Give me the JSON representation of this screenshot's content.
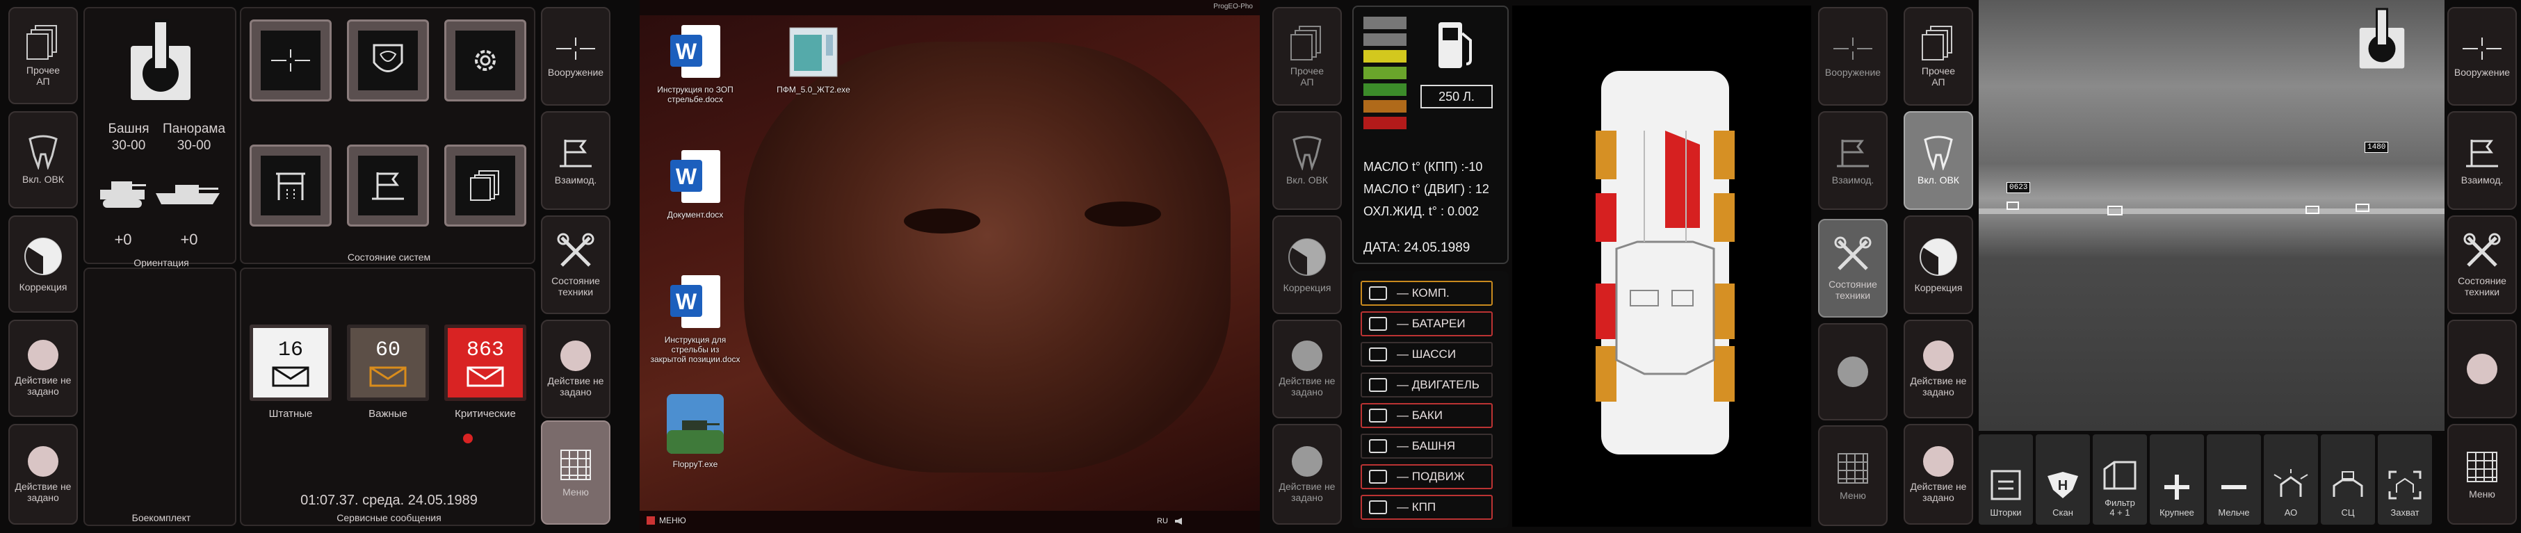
{
  "left_sidebar": {
    "items": [
      {
        "label": "Прочее\nАП",
        "icon": "documents-icon"
      },
      {
        "label": "Вкл. ОВК",
        "icon": "tooth-icon"
      },
      {
        "label": "Коррекция",
        "icon": "correction-icon"
      },
      {
        "label": "Действие не\nзадано",
        "icon": "dot-icon"
      },
      {
        "label": "Действие не\nзадано",
        "icon": "dot-icon"
      }
    ]
  },
  "orientation": {
    "tower_label": "Башня\n30-00",
    "panorama_label": "Панорама\n30-00",
    "tank_value": "+0",
    "boat_value": "+0",
    "title": "Ориентация"
  },
  "systems": {
    "title": "Состояние систем"
  },
  "ammo": {
    "title": "Боекомплект"
  },
  "service": {
    "title": "Сервисные сообщения",
    "datetime": "01:07.37. среда. 24.05.1989",
    "messages": [
      {
        "count": "16",
        "label": "Штатные",
        "color": "#f2f2f2"
      },
      {
        "count": "60",
        "label": "Важные",
        "color": "#5c4f47"
      },
      {
        "count": "863",
        "label": "Критические",
        "color": "#d92323"
      }
    ]
  },
  "right_col1": {
    "items": [
      {
        "label": "Вооружение"
      },
      {
        "label": "Взаимод."
      },
      {
        "label": "Состояние\nтехники"
      },
      {
        "label": "Действие не\nзадано"
      },
      {
        "label": "Меню"
      }
    ]
  },
  "desktop": {
    "topbar_text": "ProgEO-Pho",
    "icons": [
      {
        "label": "Инструкция по ЗОП\nстрельбе.docx"
      },
      {
        "label": "ПФМ_5.0_ЖТ2.exe"
      },
      {
        "label": "Документ.docx"
      },
      {
        "label": "Инструкция для\nстрельбы из\nзакрытой позиции.docx"
      },
      {
        "label": "FloppyT.exe"
      }
    ],
    "taskbar_menu": "МЕНЮ",
    "taskbar_lang": "RU"
  },
  "left_col2": {
    "items": [
      {
        "label": "Прочее\nАП"
      },
      {
        "label": "Вкл. ОВК"
      },
      {
        "label": "Коррекция"
      },
      {
        "label": "Действие не\nзадано"
      },
      {
        "label": "Действие не\nзадано"
      }
    ]
  },
  "vehicle_status": {
    "fuel": "250 Л.",
    "oil_kpp": "МАСЛО t° (КПП) :-10",
    "oil_engine": "МАСЛО t° (ДВИГ) : 12",
    "coolant": "ОХЛ.ЖИД. t° : 0.002",
    "date": "ДАТА: 24.05.1989",
    "fuel_levels": [
      "#777",
      "#777",
      "#d3c81e",
      "#6aa52b",
      "#3c8c2a",
      "#b06a1a",
      "#b31a1a"
    ],
    "systems": [
      {
        "label": "— КОМП.",
        "state": "orange"
      },
      {
        "label": "— БАТАРЕИ",
        "state": "warn"
      },
      {
        "label": "— ШАССИ",
        "state": "ok"
      },
      {
        "label": "— ДВИГАТЕЛЬ",
        "state": "ok"
      },
      {
        "label": "— БАКИ",
        "state": "warn"
      },
      {
        "label": "— БАШНЯ",
        "state": "ok"
      },
      {
        "label": "— ПОДВИЖ",
        "state": "warn"
      },
      {
        "label": "— КПП",
        "state": "warn"
      }
    ]
  },
  "right_col2": {
    "items": [
      {
        "label": "Вооружение"
      },
      {
        "label": "Взаимод."
      },
      {
        "label": "Состояние\nтехники"
      },
      {
        "label": ""
      },
      {
        "label": "Меню"
      }
    ]
  },
  "left_col3": {
    "items": [
      {
        "label": "Прочее\nАП"
      },
      {
        "label": "Вкл. ОВК"
      },
      {
        "label": "Коррекция"
      },
      {
        "label": "Действие не\nзадано"
      },
      {
        "label": "Действие не\nзадано"
      }
    ]
  },
  "camera": {
    "target_labels": [
      "0623",
      "1480"
    ],
    "bottom_buttons": [
      {
        "label": "Шторки"
      },
      {
        "label": "Скан"
      },
      {
        "label": "Фильтр\n4 + 1"
      },
      {
        "label": "Крупнее"
      },
      {
        "label": "Мельче"
      },
      {
        "label": "АО"
      },
      {
        "label": "СЦ"
      },
      {
        "label": "Захват"
      }
    ]
  },
  "right_col3": {
    "items": [
      {
        "label": "Вооружение"
      },
      {
        "label": "Взаимод."
      },
      {
        "label": "Состояние\nтехники"
      },
      {
        "label": ""
      },
      {
        "label": "Меню"
      }
    ]
  }
}
